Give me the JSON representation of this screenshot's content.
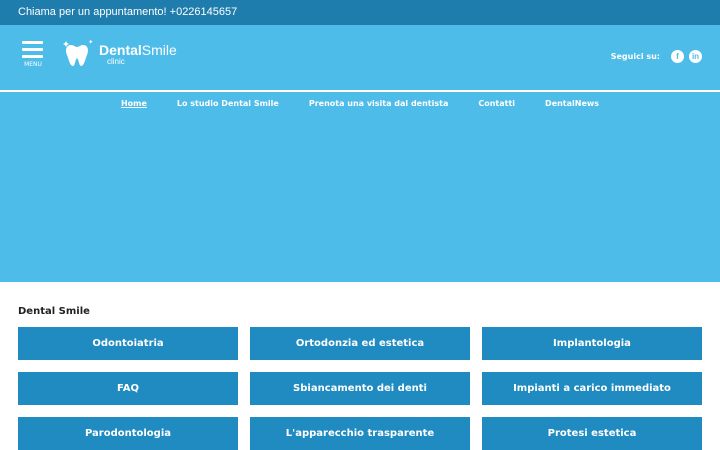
{
  "topbar": {
    "text": "Chiama per un appuntamento! +0226145657"
  },
  "header": {
    "menu_label": "MENU",
    "logo": {
      "brand_bold": "Dental",
      "brand_light": "Smile",
      "sub": "clinic"
    },
    "social": {
      "label": "Seguici su:",
      "facebook_glyph": "f",
      "linkedin_glyph": "in"
    }
  },
  "nav": {
    "items": [
      {
        "label": "Home"
      },
      {
        "label": "Lo studio Dental Smile"
      },
      {
        "label": "Prenota una visita dal dentista"
      },
      {
        "label": "Contatti"
      },
      {
        "label": "DentalNews"
      }
    ]
  },
  "main": {
    "section_title": "Dental Smile",
    "tiles": [
      "Odontoiatria",
      "Ortodonzia ed estetica",
      "Implantologia",
      "FAQ",
      "Sbiancamento dei denti",
      "Impianti a carico immediato",
      "Parodontologia",
      "L'apparecchio trasparente",
      "Protesi estetica"
    ]
  },
  "colors": {
    "topbar": "#1f7dad",
    "header": "#4ebce8",
    "tile": "#1f8bc1",
    "text_dark": "#222222"
  },
  "icons": [
    "menu-icon",
    "tooth-logo-icon",
    "facebook-icon",
    "linkedin-icon"
  ]
}
